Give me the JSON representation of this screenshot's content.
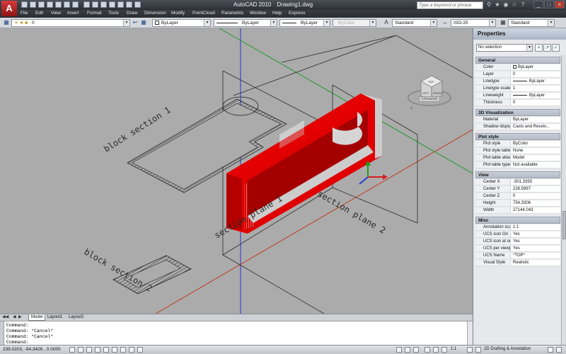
{
  "window": {
    "app_name": "AutoCAD 2010",
    "file_name": "Drawing1.dwg",
    "search_placeholder": "Type a keyword or phrase",
    "app_logo_letter": "A"
  },
  "menu": [
    "File",
    "Edit",
    "View",
    "Insert",
    "Format",
    "Tools",
    "Draw",
    "Dimension",
    "Modify",
    "PointCloud",
    "Parametric",
    "Window",
    "Help",
    "Express"
  ],
  "toolbar": {
    "layer_value": "0",
    "color_value": "ByLayer",
    "linetype_value": "ByLayer",
    "lineweight_value": "ByLayer",
    "plotstyle_value": "ByColor",
    "text_style": "Standard",
    "dim_style": "ISO-25",
    "table_style": "Standard"
  },
  "viewport": {
    "labels": [
      "block section 1",
      "section plane 1",
      "section plane 2",
      "block section 2"
    ],
    "viewcube": {
      "top": "TOP",
      "left": "LEFT",
      "right": "FRONT",
      "compass": "S"
    },
    "unsaved_tag": "Unsaved",
    "colors": {
      "background": "#ababab",
      "red_body": "#e00000",
      "red_dark": "#a40000"
    }
  },
  "tabs": [
    "Model",
    "Layout1",
    "Layout2"
  ],
  "command": {
    "lines": [
      "Command:",
      "Command: *Cancel*",
      "Command: *Cancel*",
      "Command:"
    ]
  },
  "status": {
    "coordinates": "239.0203, -94.3426 , 0.0000",
    "scale": "1:1",
    "workspace": "2D Drafting & Annotation"
  },
  "properties": {
    "title": "Properties",
    "selection": "No selection",
    "sections": [
      {
        "name": "General",
        "rows": [
          {
            "key": "Color",
            "value": "ByLayer",
            "kind": "swatch"
          },
          {
            "key": "Layer",
            "value": "0"
          },
          {
            "key": "Linetype",
            "value": "ByLayer",
            "kind": "line"
          },
          {
            "key": "Linetype scale",
            "value": "1"
          },
          {
            "key": "Lineweight",
            "value": "ByLayer",
            "kind": "line"
          },
          {
            "key": "Thickness",
            "value": "0"
          }
        ]
      },
      {
        "name": "3D Visualization",
        "rows": [
          {
            "key": "Material",
            "value": "ByLayer"
          },
          {
            "key": "Shadow display",
            "value": "Casts and Receiv..."
          }
        ]
      },
      {
        "name": "Plot style",
        "rows": [
          {
            "key": "Plot style",
            "value": "ByColor"
          },
          {
            "key": "Plot style table",
            "value": "None"
          },
          {
            "key": "Plot table attac...",
            "value": "Model"
          },
          {
            "key": "Plot table type",
            "value": "Not available"
          }
        ]
      },
      {
        "name": "View",
        "rows": [
          {
            "key": "Center X",
            "value": "-301.3393"
          },
          {
            "key": "Center Y",
            "value": "226.5997"
          },
          {
            "key": "Center Z",
            "value": "0"
          },
          {
            "key": "Height",
            "value": "754.3306"
          },
          {
            "key": "Width",
            "value": "27144.043"
          }
        ]
      },
      {
        "name": "Misc",
        "rows": [
          {
            "key": "Annotation scale",
            "value": "1:1"
          },
          {
            "key": "UCS icon On",
            "value": "Yes"
          },
          {
            "key": "UCS icon at origin",
            "value": "Yes"
          },
          {
            "key": "UCS per viewport",
            "value": "Yes"
          },
          {
            "key": "UCS Name",
            "value": "*TOP*"
          },
          {
            "key": "Visual Style",
            "value": "Realistic"
          }
        ]
      }
    ]
  }
}
